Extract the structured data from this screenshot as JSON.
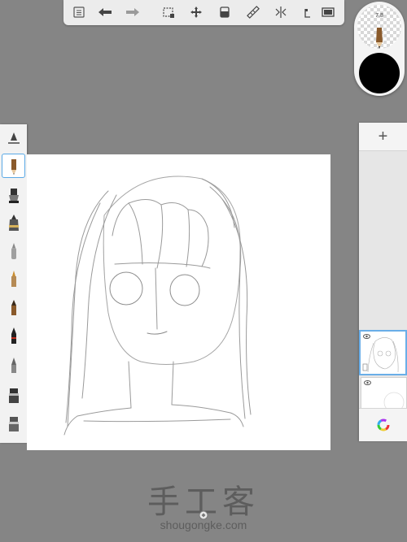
{
  "toolbar": {
    "items": [
      "list-icon",
      "undo-icon",
      "redo-icon",
      "selection-icon",
      "transform-icon",
      "layer-fill-icon",
      "ruler-icon",
      "symmetry-icon",
      "perspective-icon",
      "fullscreen-icon"
    ]
  },
  "puck": {
    "brush_size": "7.8",
    "current_color": "#000000"
  },
  "brushes": {
    "selected_index": 1,
    "items": [
      "ruler-brush",
      "pencil",
      "ink-pen",
      "marker",
      "fineliner",
      "brush-pen",
      "paint-brush",
      "calligraphy",
      "airbrush",
      "eraser-1",
      "eraser-2"
    ]
  },
  "layers": {
    "add_label": "+",
    "items": [
      {
        "name": "layer-1",
        "selected": true
      },
      {
        "name": "layer-2",
        "selected": false
      }
    ]
  },
  "colors": {
    "background": "#858585",
    "panel": "#f2f2f2",
    "selection": "#5aa9e6"
  },
  "watermark": {
    "cn": "手工客",
    "en": "shougongke.com"
  }
}
